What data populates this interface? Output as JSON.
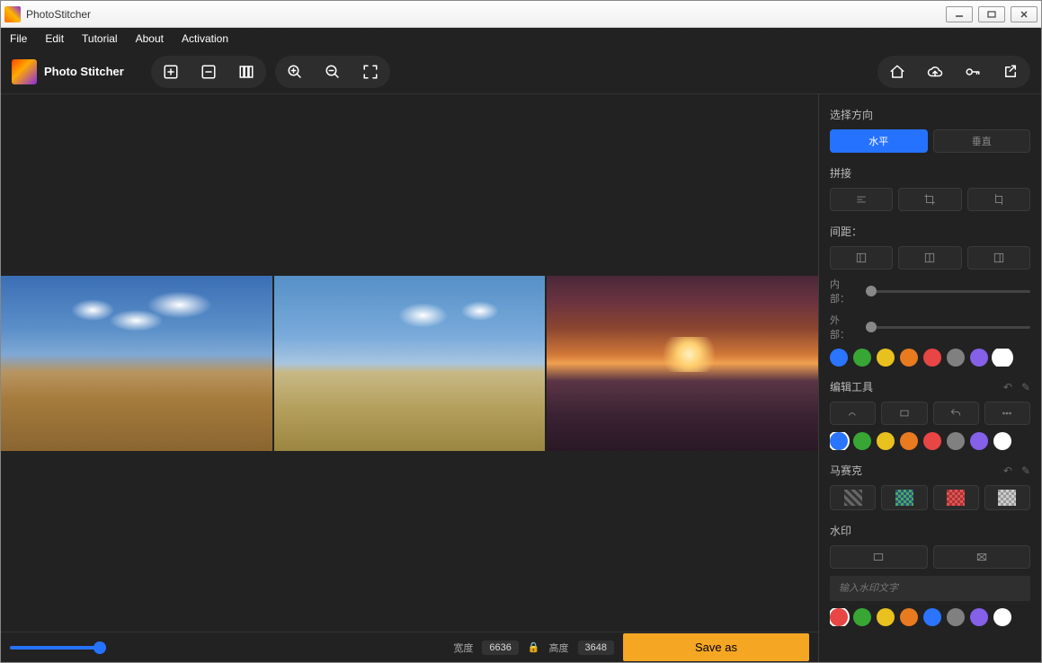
{
  "window": {
    "title": "PhotoStitcher"
  },
  "menubar": {
    "file": "File",
    "edit": "Edit",
    "tutorial": "Tutorial",
    "about": "About",
    "activation": "Activation"
  },
  "branding": {
    "name": "Photo Stitcher"
  },
  "toolbar_icons": {
    "add_image": "add-image-icon",
    "remove_image": "remove-image-icon",
    "layout": "layout-icon",
    "zoom_in": "zoom-in-icon",
    "zoom_out": "zoom-out-icon",
    "fit": "fit-screen-icon",
    "home": "home-icon",
    "cloud": "cloud-upload-icon",
    "key": "key-icon",
    "export": "export-icon"
  },
  "sidebar": {
    "direction": {
      "title": "选择方向",
      "horizontal": "水平",
      "vertical": "垂直"
    },
    "stitch": {
      "title": "拼接"
    },
    "spacing": {
      "title": "间距：",
      "inner": "内部：",
      "outer": "外部："
    },
    "border_colors": [
      "#2a74ff",
      "#38a635",
      "#e8c11f",
      "#e87a1f",
      "#e84545",
      "#808080",
      "#8560e8",
      "#ffffff"
    ],
    "edit_tools": {
      "title": "编辑工具"
    },
    "edit_colors": [
      "#2a74ff",
      "#38a635",
      "#e8c11f",
      "#e87a1f",
      "#e84545",
      "#808080",
      "#8560e8",
      "#ffffff"
    ],
    "mosaic": {
      "title": "马赛克"
    },
    "watermark": {
      "title": "水印",
      "placeholder": "输入水印文字"
    },
    "wm_colors": [
      "#e84545",
      "#38a635",
      "#e8c11f",
      "#e87a1f",
      "#2a74ff",
      "#808080",
      "#8560e8",
      "#ffffff"
    ]
  },
  "status": {
    "zoom_percent": 100,
    "width_label": "宽度",
    "width_value": "6636",
    "height_label": "高度",
    "height_value": "3648",
    "save_label": "Save as"
  }
}
